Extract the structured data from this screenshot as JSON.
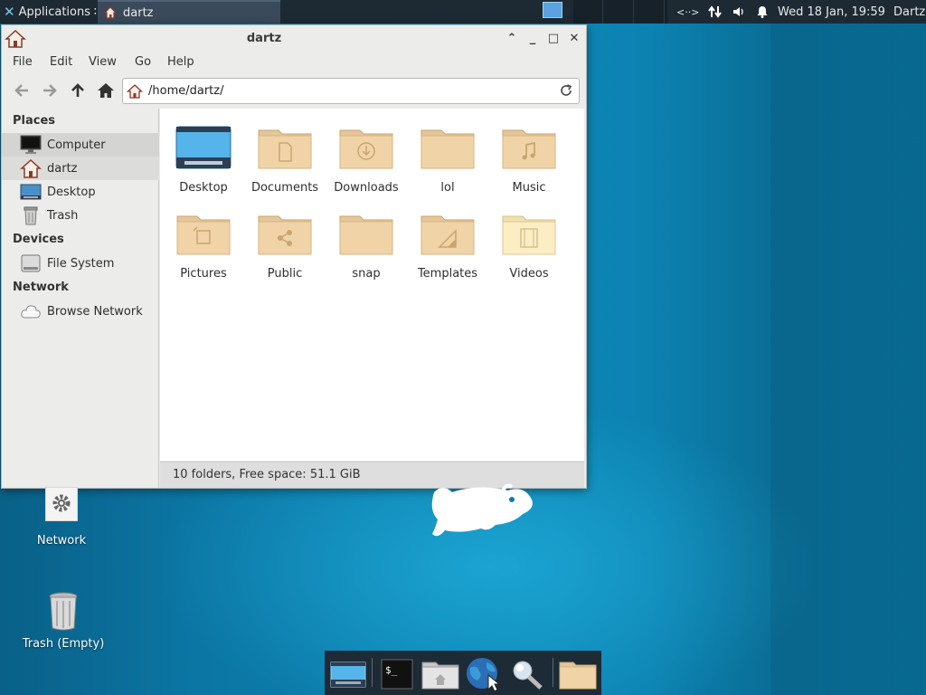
{
  "top_panel": {
    "applications_label": "Applications",
    "applications_suffix": "∷",
    "task_label": "dartz",
    "clock": "Wed 18 Jan, 19:59",
    "user": "Dartz",
    "network_indicator": "<··>",
    "icons": [
      "xfce-icon",
      "home-icon",
      "network-arrows-icon",
      "volume-icon",
      "notification-bell-icon"
    ]
  },
  "window": {
    "title": "dartz",
    "menu": {
      "file": "File",
      "edit": "Edit",
      "view": "View",
      "go": "Go",
      "help": "Help"
    },
    "location": "/home/dartz/",
    "status": "10 folders, Free space: 51.1 GiB"
  },
  "sidebar": {
    "places_heading": "Places",
    "places": [
      {
        "label": "Computer",
        "icon": "monitor-icon"
      },
      {
        "label": "dartz",
        "icon": "home-icon"
      },
      {
        "label": "Desktop",
        "icon": "desktop-icon"
      },
      {
        "label": "Trash",
        "icon": "trash-icon"
      }
    ],
    "devices_heading": "Devices",
    "devices": [
      {
        "label": "File System",
        "icon": "drive-icon"
      }
    ],
    "network_heading": "Network",
    "network": [
      {
        "label": "Browse Network",
        "icon": "cloud-icon"
      }
    ]
  },
  "files": [
    {
      "label": "Desktop",
      "icon": "desktop-folder-icon"
    },
    {
      "label": "Documents",
      "icon": "documents-folder-icon"
    },
    {
      "label": "Downloads",
      "icon": "downloads-folder-icon"
    },
    {
      "label": "lol",
      "icon": "folder-icon"
    },
    {
      "label": "Music",
      "icon": "music-folder-icon"
    },
    {
      "label": "Pictures",
      "icon": "pictures-folder-icon"
    },
    {
      "label": "Public",
      "icon": "public-folder-icon"
    },
    {
      "label": "snap",
      "icon": "folder-icon"
    },
    {
      "label": "Templates",
      "icon": "templates-folder-icon"
    },
    {
      "label": "Videos",
      "icon": "videos-folder-icon"
    }
  ],
  "desktop": {
    "network_label": "Network",
    "trash_label": "Trash (Empty)"
  },
  "dock": [
    "show-desktop-icon",
    "terminal-icon",
    "home-folder-icon",
    "web-browser-icon",
    "search-icon",
    "folder-icon"
  ],
  "colors": {
    "folder": "#f0d4a8",
    "folder_dark": "#d8b37e",
    "panel": "#1e2a33",
    "desktop": "#0c7fae"
  }
}
